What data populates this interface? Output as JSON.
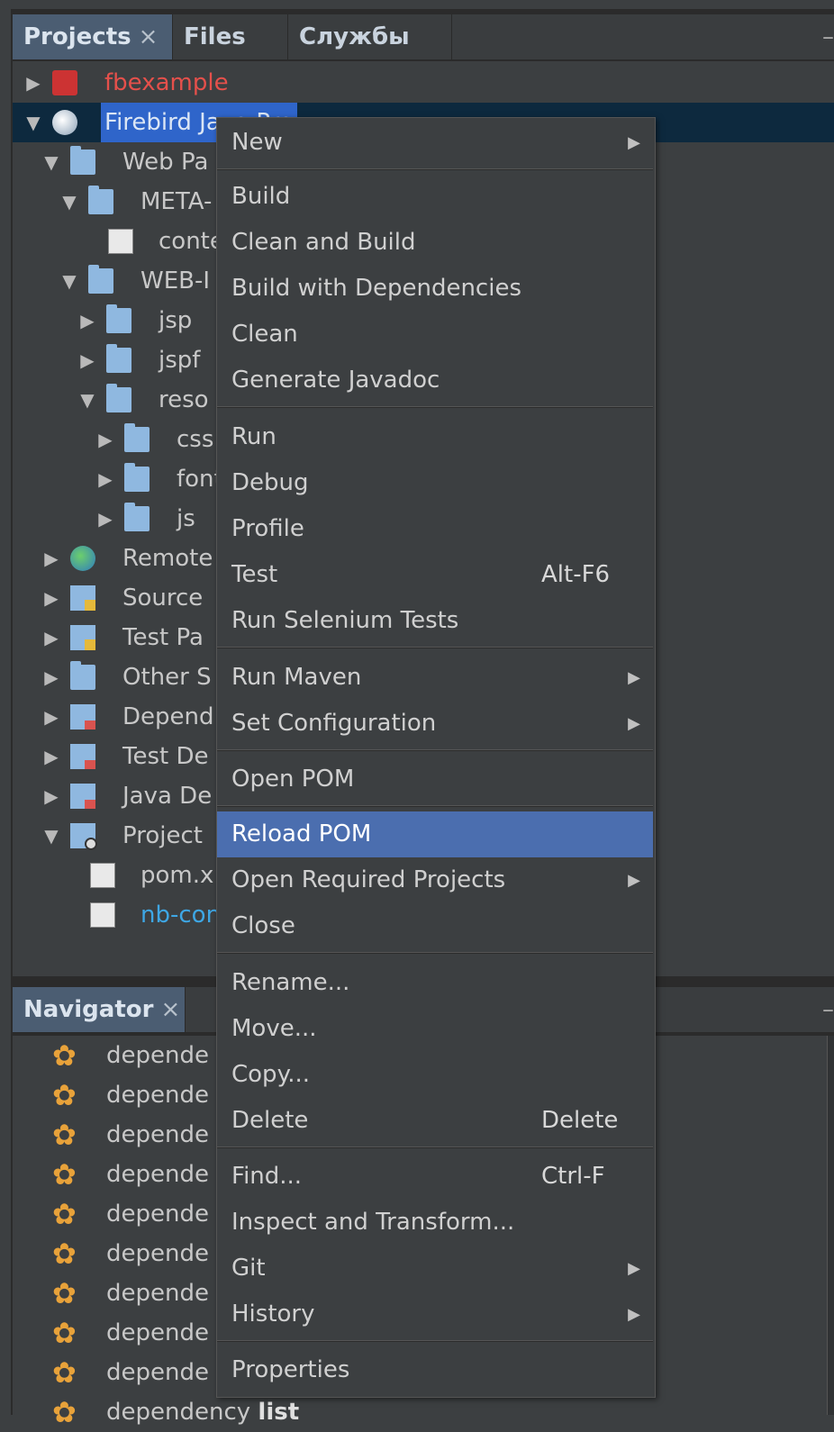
{
  "tabs_top": {
    "projects": "Projects",
    "files": "Files",
    "services": "Службы",
    "close": "×",
    "minimize": "–"
  },
  "tree": {
    "fbexample": "fbexample",
    "firebird": "Firebird J",
    "firebird_tail": "ava Pro",
    "web_pages": "Web Pa",
    "meta_inf": "META-",
    "context": "conte",
    "web_inf": "WEB-I",
    "jsp": "jsp",
    "jspf": "jspf",
    "resources": "reso",
    "css": "css",
    "fonts": "font",
    "js": "js",
    "remote": "Remote",
    "source": "Source",
    "test_packages": "Test Pa",
    "other_sources": "Other S",
    "dependencies": "Depend",
    "test_dependencies": "Test De",
    "java_dependencies": "Java De",
    "project_files": "Project",
    "pom": "pom.x",
    "nb_config": "nb-con"
  },
  "navigator": {
    "title": "Navigator",
    "close": "×",
    "minimize": "–",
    "rows": [
      "depende",
      "depende",
      "depende",
      "depende",
      "depende",
      "depende",
      "depende",
      "depende",
      "depende"
    ],
    "last_row_prefix": "dependency",
    "last_row_bold": "list"
  },
  "menu": {
    "new": "New",
    "build": "Build",
    "clean_build": "Clean and Build",
    "build_deps": "Build with Dependencies",
    "clean": "Clean",
    "javadoc": "Generate Javadoc",
    "run": "Run",
    "debug": "Debug",
    "profile": "Profile",
    "test": "Test",
    "test_shortcut": "Alt-F6",
    "selenium": "Run Selenium Tests",
    "run_maven": "Run Maven",
    "set_config": "Set Configuration",
    "open_pom": "Open POM",
    "reload_pom": "Reload POM",
    "open_required": "Open Required Projects",
    "close": "Close",
    "rename": "Rename...",
    "move": "Move...",
    "copy": "Copy...",
    "delete": "Delete",
    "delete_shortcut": "Delete",
    "find": "Find...",
    "find_shortcut": "Ctrl-F",
    "inspect": "Inspect and Transform...",
    "git": "Git",
    "history": "History",
    "properties": "Properties"
  },
  "icons": {
    "submenu_arrow": "▶",
    "expanded": "▼",
    "collapsed": "▶",
    "gear": "✿"
  },
  "colors": {
    "background": "#3c3f41",
    "selection": "#4b6eaf",
    "error_project": "#e5504b",
    "link_file": "#3ea7e5"
  }
}
